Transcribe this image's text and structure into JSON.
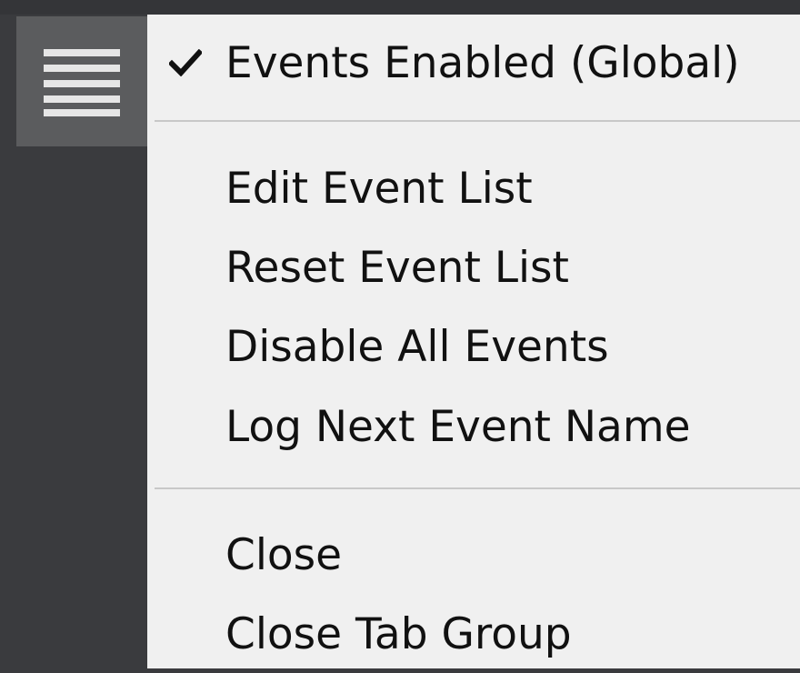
{
  "toolbar": {
    "menu_button_icon": "hamburger-menu-icon"
  },
  "menu": {
    "events_enabled": {
      "label": "Events Enabled (Global)",
      "checked": true
    },
    "edit_event_list": "Edit Event List",
    "reset_event_list": "Reset Event List",
    "disable_all_events": "Disable All Events",
    "log_next_event_name": "Log Next Event Name",
    "close": "Close",
    "close_tab_group": "Close Tab Group"
  },
  "colors": {
    "background": "#3a3b3e",
    "menu_button_bg": "#5b5c5e",
    "menu_bg": "#f0f0f0",
    "separator": "#c8c8c8",
    "text": "#111111"
  }
}
